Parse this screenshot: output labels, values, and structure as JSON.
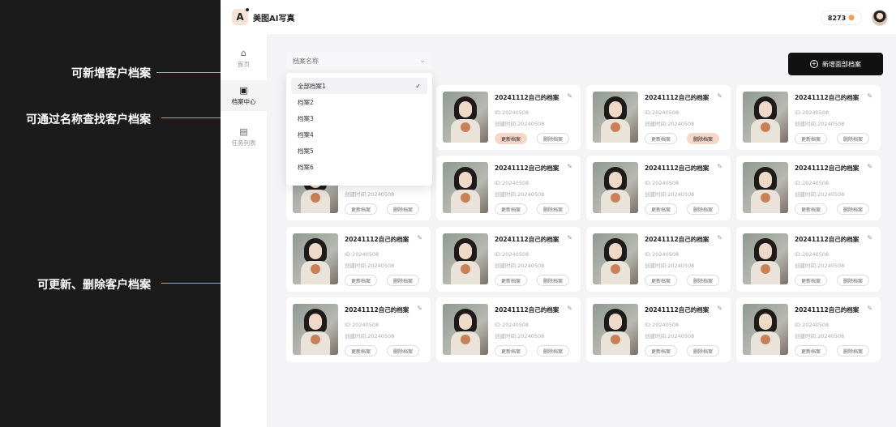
{
  "annotations": {
    "new_profile": "可新增客户档案",
    "search_by_name": "可通过名称查找客户档案",
    "update_delete": "可更新、删除客户档案"
  },
  "app": {
    "title": "美图AI写真",
    "logo_text": "A",
    "credits": "8273",
    "credits_icon": "coin-icon"
  },
  "sidenav": {
    "items": [
      {
        "label": "首页",
        "icon": "home-icon"
      },
      {
        "label": "档案中心",
        "icon": "profile-icon"
      },
      {
        "label": "任务列表",
        "icon": "task-list-icon"
      }
    ]
  },
  "search": {
    "placeholder": "档案名称"
  },
  "new_button": {
    "label": "新增面部档案"
  },
  "dropdown": {
    "options": [
      "全部档案1",
      "档案2",
      "档案3",
      "档案4",
      "档案5",
      "档案6"
    ],
    "selected": "全部档案1"
  },
  "card": {
    "title": "20241112自己的档案",
    "id": "ID:20240508",
    "created": "创建时间:20240508",
    "update_label": "更新档案",
    "delete_label": "删除档案"
  },
  "colors": {
    "accent": "#f7d7c8",
    "primary_button": "#111111",
    "annotation_line": "#c99a84"
  }
}
